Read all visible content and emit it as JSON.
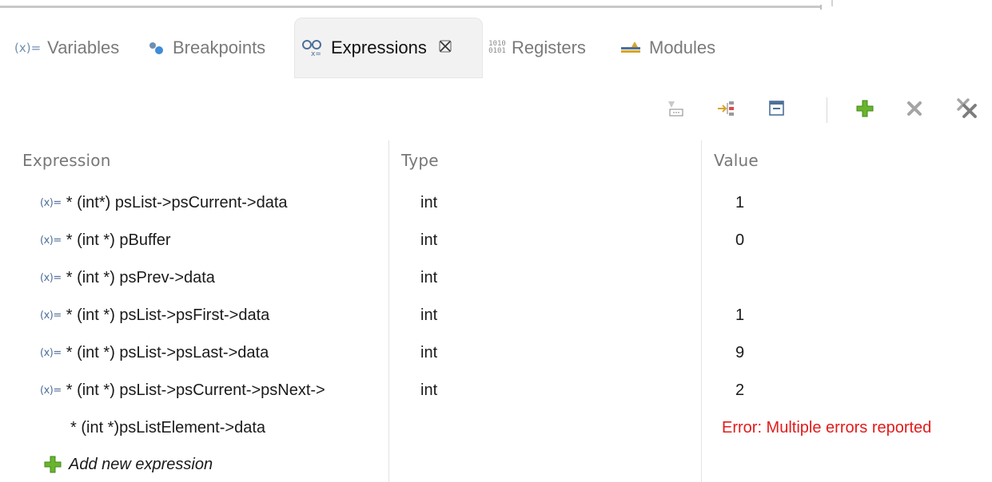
{
  "tabs": [
    {
      "label": "Variables",
      "icon": "variables-icon",
      "active": false
    },
    {
      "label": "Breakpoints",
      "icon": "breakpoints-icon",
      "active": false
    },
    {
      "label": "Expressions",
      "icon": "expressions-icon",
      "active": true
    },
    {
      "label": "Registers",
      "icon": "registers-icon",
      "active": false
    },
    {
      "label": "Modules",
      "icon": "modules-icon",
      "active": false
    }
  ],
  "toolbar": {
    "icons": [
      "show-type-names-icon",
      "show-logical-structure-icon",
      "collapse-all-icon",
      "add-expression-icon",
      "remove-expression-icon",
      "remove-all-expressions-icon"
    ]
  },
  "columns": [
    "Expression",
    "Type",
    "Value"
  ],
  "rows": [
    {
      "expression": "* (int*) psList->psCurrent->data",
      "type": "int",
      "value": "1"
    },
    {
      "expression": "* (int *) pBuffer",
      "type": "int",
      "value": "0"
    },
    {
      "expression": "* (int *) psPrev->data",
      "type": "int",
      "value": ""
    },
    {
      "expression": "* (int *) psList->psFirst->data",
      "type": "int",
      "value": "1"
    },
    {
      "expression": "* (int *) psList->psLast->data",
      "type": "int",
      "value": "9"
    },
    {
      "expression": "* (int *) psList->psCurrent->psNext->",
      "type": "int",
      "value": "2"
    },
    {
      "expression": "* (int *)psListElement->data",
      "type": "",
      "value": "Error: Multiple errors reported"
    }
  ],
  "add_expression_label": "Add new expression",
  "colors": {
    "error": "#e21b1b",
    "add_green": "#6ab42d",
    "remove_gray": "#9a9a9a"
  }
}
